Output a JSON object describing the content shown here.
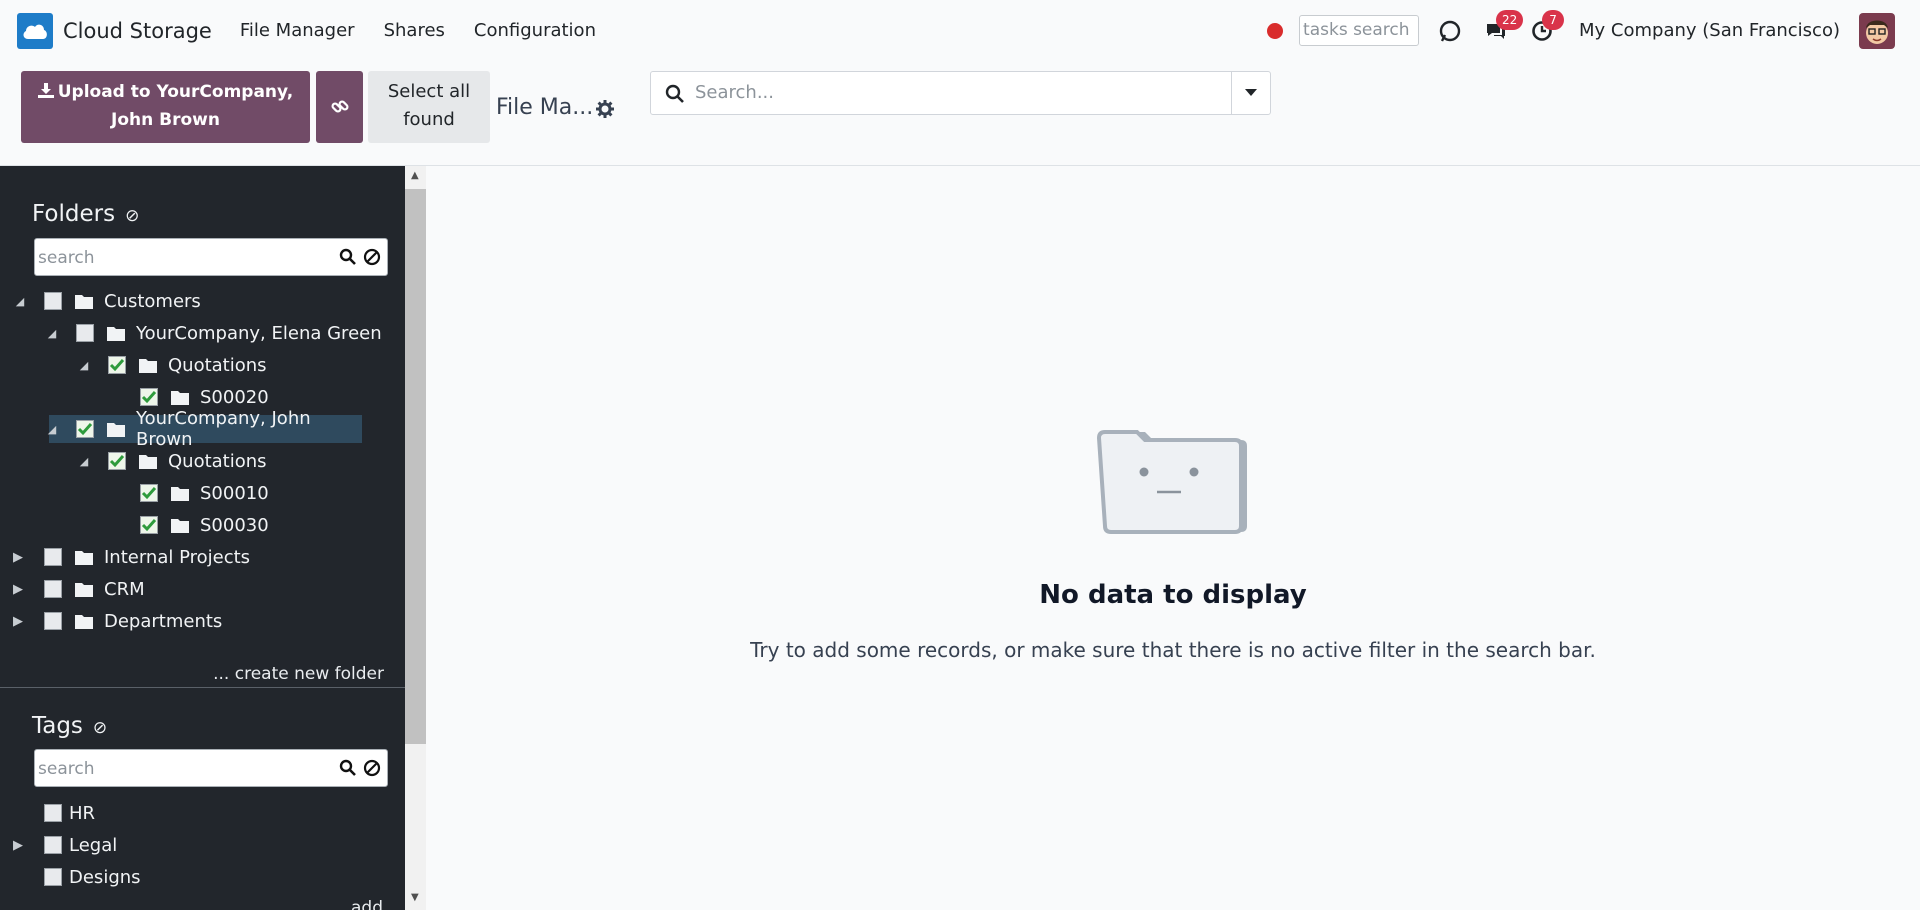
{
  "navbar": {
    "app_name": "Cloud Storage",
    "menu": [
      "File Manager",
      "Shares",
      "Configuration"
    ],
    "tasks_search_placeholder": "tasks search",
    "messages_count": "22",
    "activities_count": "7",
    "company": "My Company (San Francisco)"
  },
  "control_panel": {
    "upload_button": "Upload to YourCompany, John Brown",
    "upload_line1": "Upload to YourCompany,",
    "upload_line2": "John Brown",
    "select_all_line1": "Select all",
    "select_all_line2": "found",
    "breadcrumb": "File Ma...",
    "search_placeholder": "Search..."
  },
  "sidebar": {
    "folders_title": "Folders",
    "folders_search_placeholder": "search",
    "folders": [
      {
        "label": "Customers",
        "checked": false
      },
      {
        "label": "YourCompany, Elena Green",
        "checked": false
      },
      {
        "label": "Quotations",
        "checked": true
      },
      {
        "label": "S00020",
        "checked": true
      },
      {
        "label": "YourCompany, John Brown",
        "checked": true,
        "selected": true
      },
      {
        "label": "Quotations",
        "checked": true
      },
      {
        "label": "S00010",
        "checked": true
      },
      {
        "label": "S00030",
        "checked": true
      },
      {
        "label": "Internal Projects",
        "checked": false
      },
      {
        "label": "CRM",
        "checked": false
      },
      {
        "label": "Departments",
        "checked": false
      }
    ],
    "create_folder": "... create new folder",
    "tags_title": "Tags",
    "tags_search_placeholder": "search",
    "tags": [
      {
        "label": "HR"
      },
      {
        "label": "Legal"
      },
      {
        "label": "Designs"
      }
    ],
    "tags_add": "add"
  },
  "empty_state": {
    "title": "No data to display",
    "text": "Try to add some records, or make sure that there is no active filter in the search bar."
  },
  "colors": {
    "primary": "#714b67",
    "sidebar_bg": "#22262c",
    "badge": "#d9334a",
    "status_dot": "#d92c2c"
  }
}
